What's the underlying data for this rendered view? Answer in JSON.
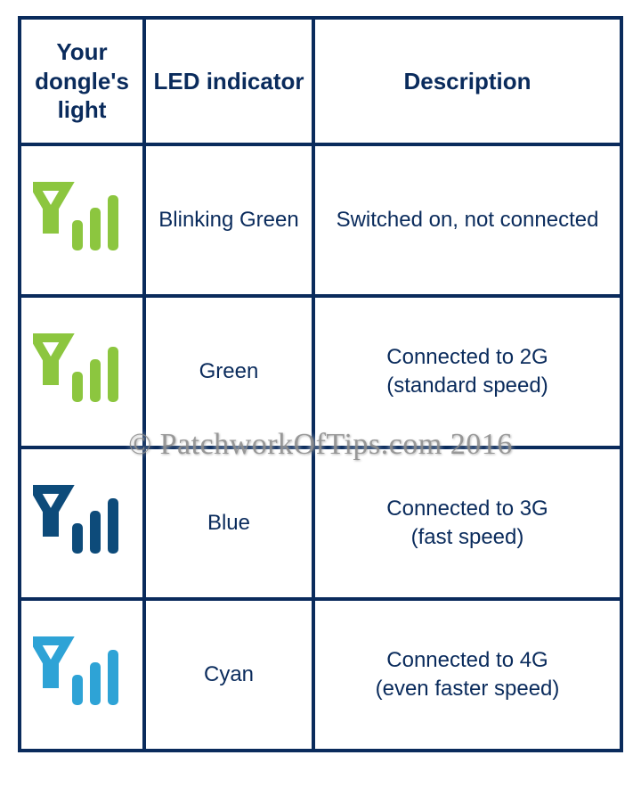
{
  "table": {
    "headers": {
      "icon": "Your dongle's light",
      "led": "LED indicator",
      "desc": "Description"
    },
    "rows": [
      {
        "icon_color": "#8cc63f",
        "led": "Blinking Green",
        "desc_line1": "Switched on, not connected",
        "desc_line2": ""
      },
      {
        "icon_color": "#8cc63f",
        "led": "Green",
        "desc_line1": "Connected to 2G",
        "desc_line2": "(standard speed)"
      },
      {
        "icon_color": "#0d4b7a",
        "led": "Blue",
        "desc_line1": "Connected to 3G",
        "desc_line2": "(fast speed)"
      },
      {
        "icon_color": "#2ea3d6",
        "led": "Cyan",
        "desc_line1": "Connected to 4G",
        "desc_line2": "(even faster speed)"
      }
    ]
  },
  "watermark": "© PatchworkOfTips.com 2016"
}
